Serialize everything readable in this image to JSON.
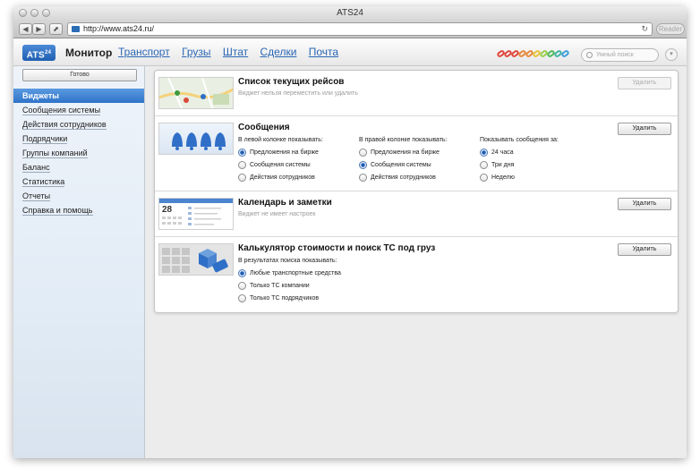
{
  "browser": {
    "window_title": "ATS24",
    "url": "http://www.ats24.ru/",
    "reader_label": "Reader",
    "back_glyph": "◀",
    "forward_glyph": "▶",
    "share_glyph": "⬈",
    "reload_glyph": "↻"
  },
  "header": {
    "logo_text": "ATS",
    "logo_sup": "24",
    "title": "Монитор",
    "nav": [
      "Транспорт",
      "Грузы",
      "Штат",
      "Сделки",
      "Почта"
    ],
    "search_placeholder": "Умный поиск",
    "settings_glyph": "▾",
    "clip_colors": [
      "#e0463c",
      "#e0463c",
      "#e0463c",
      "#e6893a",
      "#e6893a",
      "#e8c23a",
      "#9acd49",
      "#4fb85b",
      "#42b3a6",
      "#3da0d8"
    ]
  },
  "sidebar": {
    "done_label": "Готово",
    "items": [
      "Виджеты",
      "Сообщения системы",
      "Действия сотрудников",
      "Подрядчики",
      "Группы компаний",
      "Баланс",
      "Статистика",
      "Отчеты",
      "Справка и помощь"
    ],
    "active_index": 0
  },
  "widgets": {
    "trips": {
      "title": "Список текущих рейсов",
      "subtitle": "Виджет нельзя переместить или удалить",
      "delete_label": "Удалить"
    },
    "messages": {
      "title": "Сообщения",
      "delete_label": "Удалить",
      "left": {
        "header": "В левой колонке показывать:",
        "options": [
          "Предложения на бирже",
          "Сообщения системы",
          "Действия сотрудников"
        ],
        "selected": 0
      },
      "right": {
        "header": "В правой колонке показывать:",
        "options": [
          "Предложения на бирже",
          "Сообщения системы",
          "Действия сотрудников"
        ],
        "selected": 1
      },
      "period": {
        "header": "Показывать сообщения за:",
        "options": [
          "24 часа",
          "Три дня",
          "Неделю"
        ],
        "selected": 0
      }
    },
    "calendar": {
      "title": "Календарь и заметки",
      "subtitle": "Виджет не имеет настроек",
      "delete_label": "Удалить",
      "thumb_day": "28"
    },
    "calculator": {
      "title": "Калькулятор стоимости и поиск ТС под груз",
      "delete_label": "Удалить",
      "results": {
        "header": "В результатах поиска показывать:",
        "options": [
          "Любые транспортные средства",
          "Только ТС компании",
          "Только ТС подрядчиков"
        ],
        "selected": 0
      }
    }
  }
}
